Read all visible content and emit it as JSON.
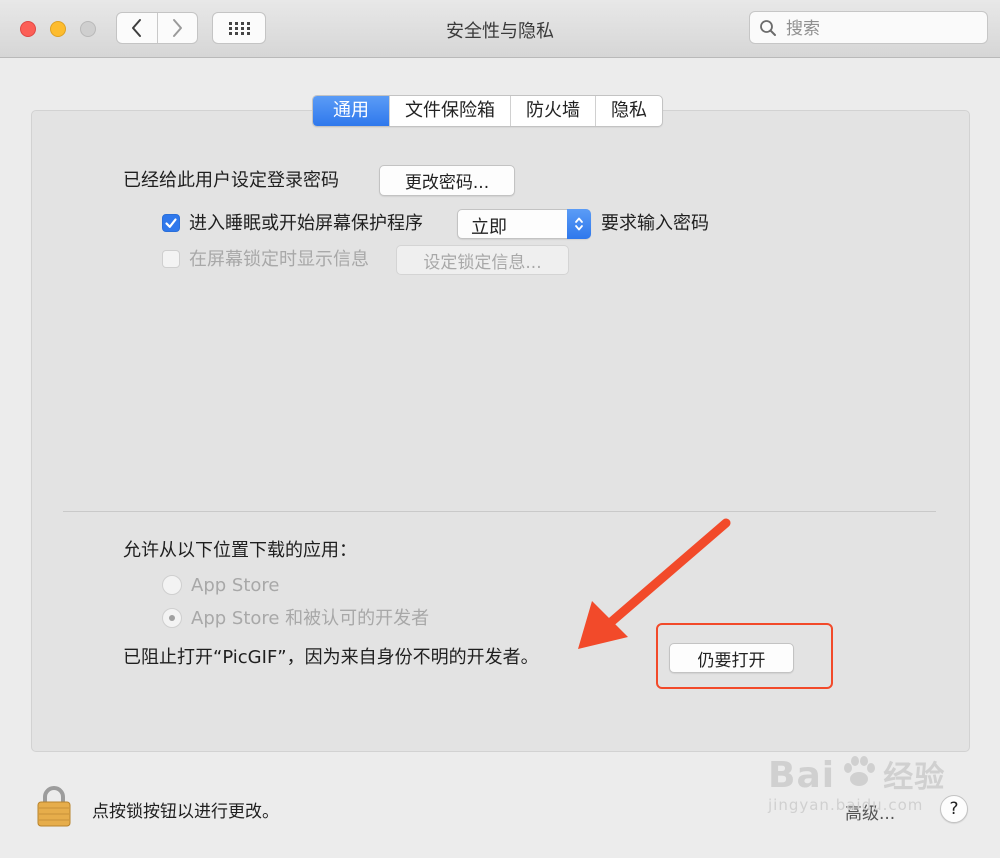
{
  "window": {
    "title": "安全性与隐私",
    "search_placeholder": "搜索"
  },
  "toolbar": {
    "back_icon": "chevron-left",
    "forward_icon": "chevron-right",
    "grid_icon": "grid-dots"
  },
  "tabs": [
    {
      "label": "通用",
      "active": true
    },
    {
      "label": "文件保险箱",
      "active": false
    },
    {
      "label": "防火墙",
      "active": false
    },
    {
      "label": "隐私",
      "active": false
    }
  ],
  "general": {
    "password_set_label": "已经给此用户设定登录密码",
    "change_password_button": "更改密码...",
    "require_password": {
      "checked": true,
      "label": "进入睡眠或开始屏幕保护程序",
      "delay_value": "立即",
      "suffix": "要求输入密码"
    },
    "lock_message": {
      "checked": false,
      "enabled": false,
      "label": "在屏幕锁定时显示信息",
      "button": "设定锁定信息..."
    }
  },
  "downloads": {
    "heading": "允许从以下位置下载的应用：",
    "options": [
      {
        "label": "App Store",
        "selected": false,
        "enabled": false
      },
      {
        "label": "App Store 和被认可的开发者",
        "selected": true,
        "enabled": false
      }
    ],
    "blocked_message": "已阻止打开“PicGIF”，因为来自身份不明的开发者。",
    "open_anyway_button": "仍要打开"
  },
  "footer": {
    "lock_text": "点按锁按钮以进行更改。",
    "advanced_button": "高级...",
    "help_button": "?"
  },
  "annotation": {
    "highlight_color": "#f24a2a",
    "arrow_color": "#f24a2a"
  },
  "watermark": {
    "brand": "Bai",
    "brand_suffix": "经验",
    "url": "jingyan.baidu.com"
  },
  "colors": {
    "accent": "#2f78ec",
    "close": "#fc5f57",
    "minimize": "#fdbc2e",
    "zoom": "#cfcfcf"
  }
}
